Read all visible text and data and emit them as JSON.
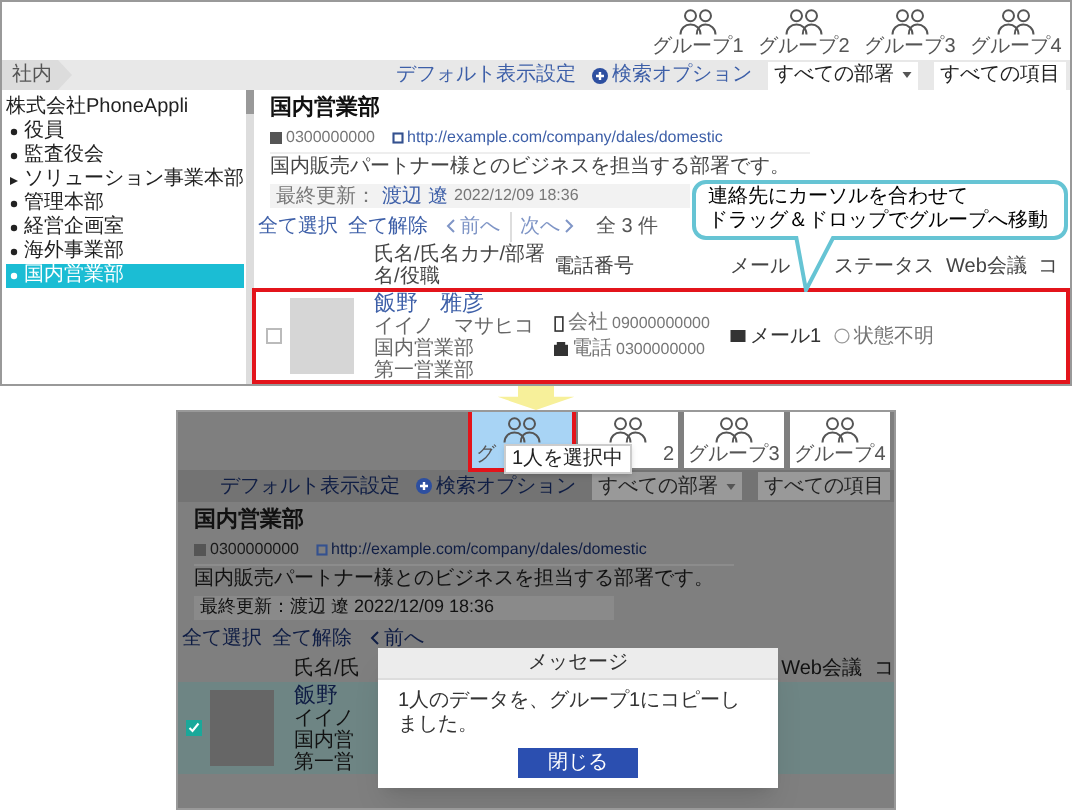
{
  "before": {
    "groups": [
      {
        "label": "グループ1"
      },
      {
        "label": "グループ2"
      },
      {
        "label": "グループ3"
      },
      {
        "label": "グループ4"
      }
    ],
    "breadcrumb": "社内",
    "toolbar": {
      "default_view": "デフォルト表示設定",
      "search_options": "検索オプション",
      "department_select": "すべての部署",
      "field_select": "すべての項目"
    },
    "sidebar": {
      "root": "株式会社PhoneAppli",
      "items": [
        {
          "label": "役員",
          "kind": "leaf",
          "selected": false
        },
        {
          "label": "監査役会",
          "kind": "leaf",
          "selected": false
        },
        {
          "label": "ソリューション事業本部",
          "kind": "branch",
          "expanded": false,
          "selected": false
        },
        {
          "label": "管理本部",
          "kind": "leaf",
          "selected": false
        },
        {
          "label": "経営企画室",
          "kind": "leaf",
          "selected": false
        },
        {
          "label": "海外事業部",
          "kind": "leaf",
          "selected": false
        },
        {
          "label": "国内営業部",
          "kind": "leaf",
          "selected": true
        }
      ]
    },
    "department": {
      "name": "国内営業部",
      "phone": "0300000000",
      "url": "http://example.com/company/dales/domestic",
      "description": "国内販売パートナー様とのビジネスを担当する部署です。",
      "updated_label": "最終更新：",
      "updated_user": "渡辺",
      "updated_user2": "遼",
      "updated_date": "2022/12/09 18:36"
    },
    "list_toolbar": {
      "select_all": "全て選択",
      "clear_all": "全て解除",
      "prev": "前へ",
      "next": "次へ",
      "count": "全 3 件"
    },
    "columns": [
      "氏名/氏名カナ/部署名/役職",
      "電話番号",
      "メール",
      "ステータス",
      "Web会議",
      "コ"
    ],
    "contact": {
      "checked": false,
      "name": "飯野　雅彦",
      "kana": "イイノ　マサヒコ",
      "departments": [
        "国内営業部",
        "第一営業部"
      ],
      "phones": [
        {
          "kind": "mobile",
          "label": "会社",
          "number": "09000000000"
        },
        {
          "kind": "landline",
          "label": "電話",
          "number": "0300000000"
        }
      ],
      "mail": "メール1",
      "status": "状態不明"
    }
  },
  "callout": {
    "lines": [
      "連絡先にカーソルを合わせて",
      "ドラッグ＆ドロップでグループへ移動"
    ]
  },
  "after": {
    "groups": [
      {
        "label": "グ",
        "selected": true
      },
      {
        "label": "2",
        "selected": false
      },
      {
        "label": "グループ3",
        "selected": false
      },
      {
        "label": "グループ4",
        "selected": false
      }
    ],
    "tooltip": "1人を選択中",
    "toolbar": {
      "default_view": "デフォルト表示設定",
      "search_options": "検索オプション",
      "department_select": "すべての部署",
      "field_select": "すべての項目"
    },
    "department": {
      "name": "国内営業部",
      "phone": "0300000000",
      "url": "http://example.com/company/dales/domestic",
      "description": "国内販売パートナー様とのビジネスを担当する部署です。",
      "updated": "最終更新：渡辺 遼 2022/12/09 18:36"
    },
    "list_toolbar": {
      "select_all": "全て選択",
      "clear_all": "全て解除",
      "prev": "前へ"
    },
    "columns": [
      "氏名/氏",
      "Web会議",
      "コ"
    ],
    "contact": {
      "checked": true,
      "name": "飯野",
      "kana": "イイノ",
      "departments": [
        "国内営",
        "第一営"
      ]
    },
    "dialog": {
      "title": "メッセージ",
      "message": "1人のデータを、グループ1にコピーしました。",
      "button": "閉じる"
    }
  }
}
